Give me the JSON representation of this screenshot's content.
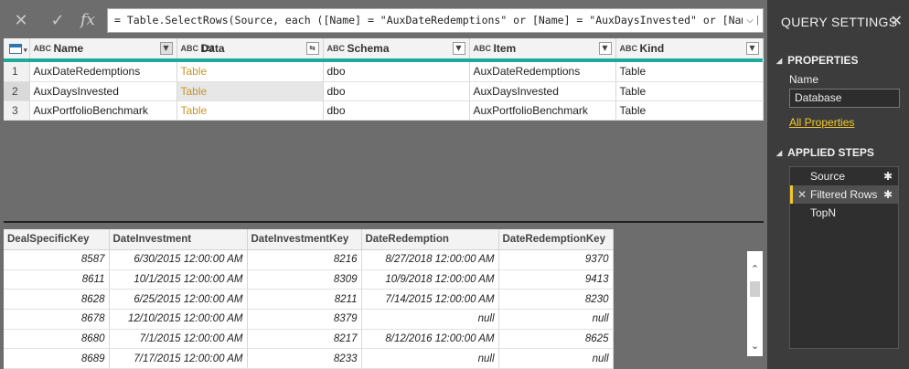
{
  "formula": {
    "cancel_icon": "✕",
    "commit_icon": "✓",
    "fx_label": "fx",
    "text": "= Table.SelectRows(Source, each ([Name] = \"AuxDateRedemptions\" or [Name] = \"AuxDaysInvested\" or [Name]",
    "expand_icon": "⌵"
  },
  "top_grid": {
    "columns": [
      {
        "type": "ABC",
        "name": "Name"
      },
      {
        "type": "ABC 123",
        "name": "Data"
      },
      {
        "type": "ABC",
        "name": "Schema"
      },
      {
        "type": "ABC",
        "name": "Item"
      },
      {
        "type": "ABC",
        "name": "Kind"
      }
    ],
    "rows": [
      {
        "num": "1",
        "name": "AuxDateRedemptions",
        "data": "Table",
        "schema": "dbo",
        "item": "AuxDateRedemptions",
        "kind": "Table"
      },
      {
        "num": "2",
        "name": "AuxDaysInvested",
        "data": "Table",
        "schema": "dbo",
        "item": "AuxDaysInvested",
        "kind": "Table"
      },
      {
        "num": "3",
        "name": "AuxPortfolioBenchmark",
        "data": "Table",
        "schema": "dbo",
        "item": "AuxPortfolioBenchmark",
        "kind": "Table"
      }
    ]
  },
  "preview": {
    "columns": [
      "DealSpecificKey",
      "DateInvestment",
      "DateInvestmentKey",
      "DateRedemption",
      "DateRedemptionKey"
    ],
    "rows": [
      [
        "8587",
        "6/30/2015 12:00:00 AM",
        "8216",
        "8/27/2018 12:00:00 AM",
        "9370"
      ],
      [
        "8611",
        "10/1/2015 12:00:00 AM",
        "8309",
        "10/9/2018 12:00:00 AM",
        "9413"
      ],
      [
        "8628",
        "6/25/2015 12:00:00 AM",
        "8211",
        "7/14/2015 12:00:00 AM",
        "8230"
      ],
      [
        "8678",
        "12/10/2015 12:00:00 AM",
        "8379",
        "null",
        "null"
      ],
      [
        "8680",
        "7/1/2015 12:00:00 AM",
        "8217",
        "8/12/2016 12:00:00 AM",
        "8625"
      ],
      [
        "8689",
        "7/17/2015 12:00:00 AM",
        "8233",
        "null",
        "null"
      ]
    ]
  },
  "query_settings": {
    "title": "QUERY SETTINGS",
    "properties_heading": "PROPERTIES",
    "name_label": "Name",
    "name_value": "Database",
    "all_properties": "All Properties",
    "applied_steps_heading": "APPLIED STEPS",
    "steps": [
      "Source",
      "Filtered Rows",
      "TopN"
    ]
  },
  "colors": {
    "accent_teal": "#1fa99a",
    "link_yellow": "#f3c928",
    "table_link": "#c29628"
  }
}
